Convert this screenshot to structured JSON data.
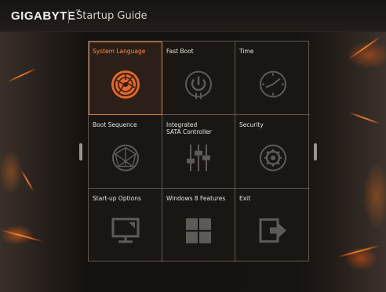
{
  "header": {
    "brand": "GIGABYTE",
    "brand_mark": "™",
    "title": "Startup Guide"
  },
  "grid": {
    "selected": "System Language",
    "items": [
      {
        "label": "System Language",
        "icon": "globe-icon"
      },
      {
        "label": "Fast Boot",
        "icon": "power-dial-icon"
      },
      {
        "label": "Time",
        "icon": "clock-icon"
      },
      {
        "label": "Boot Sequence",
        "icon": "network-icon"
      },
      {
        "label": "Integrated\nSATA Controller",
        "icon": "sliders-icon"
      },
      {
        "label": "Security",
        "icon": "gear-icon"
      },
      {
        "label": "Start-up Options",
        "icon": "monitor-icon"
      },
      {
        "label": "Windows 8 Features",
        "icon": "windows-icon"
      },
      {
        "label": "Exit",
        "icon": "exit-icon"
      }
    ]
  },
  "colors": {
    "accent": "#ff8a3a",
    "text": "#e6e3df",
    "grid_line": "#5d5853",
    "icon": "#5e5a57"
  }
}
